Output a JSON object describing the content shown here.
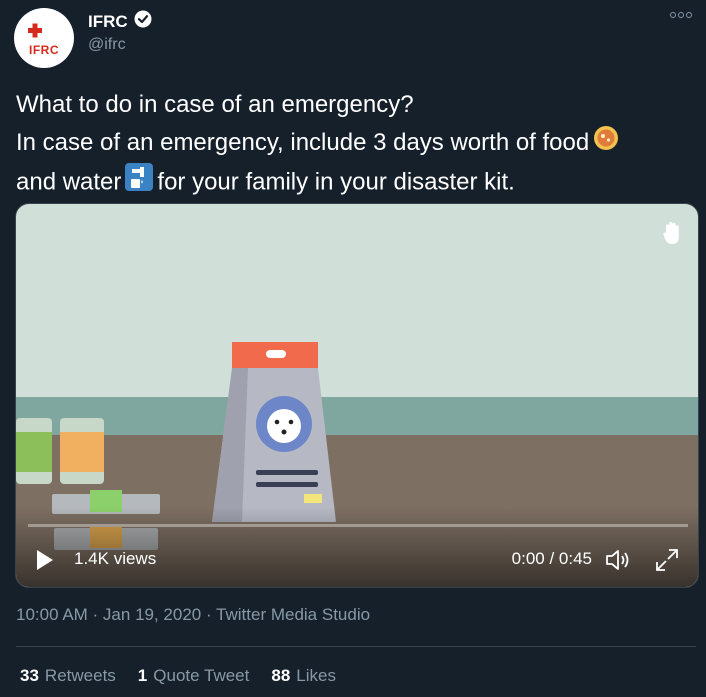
{
  "account": {
    "name": "IFRC",
    "handle": "@ifrc",
    "avatar_label": "IFRC",
    "verified": true
  },
  "tweet": {
    "lines": [
      "What to do in case of an emergency?",
      "In case of an emergency, include 3 days worth of food",
      "and water",
      "for your family in your disaster kit."
    ],
    "emojis": [
      "food-bowl-emoji",
      "potable-water-emoji"
    ]
  },
  "video": {
    "views": "1.4K views",
    "time": "0:00 / 0:45",
    "progress": 0
  },
  "meta": {
    "timestamp": "10:00 AM · Jan 19, 2020 · Twitter Media Studio"
  },
  "stats": {
    "retweets_count": "33",
    "retweets_label": "Retweets",
    "quotes_count": "1",
    "quotes_label": "Quote Tweet",
    "likes_count": "88",
    "likes_label": "Likes"
  },
  "colors": {
    "background": "#15202b",
    "secondary_text": "#8899a6",
    "brand_red": "#d52b1e"
  }
}
